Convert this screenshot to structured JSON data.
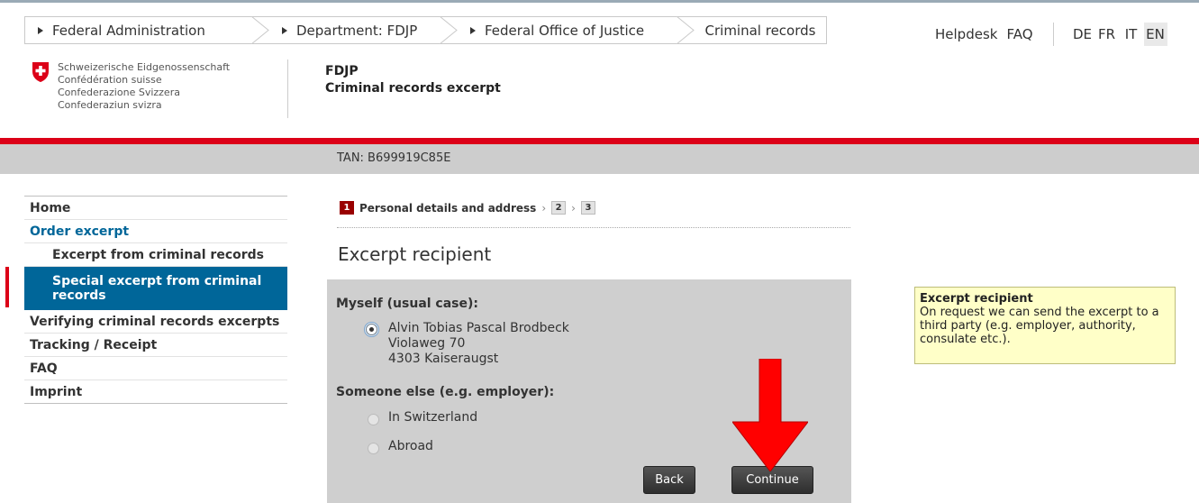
{
  "breadcrumb": {
    "items": [
      {
        "label": "Federal Administration"
      },
      {
        "label": "Department: FDJP"
      },
      {
        "label": "Federal Office of Justice"
      },
      {
        "label": "Criminal records"
      }
    ]
  },
  "meta_nav": {
    "helpdesk": "Helpdesk",
    "faq": "FAQ",
    "languages": [
      "DE",
      "FR",
      "IT",
      "EN"
    ],
    "active_language": "EN"
  },
  "logo": {
    "lines": [
      "Schweizerische Eidgenossenschaft",
      "Confédération suisse",
      "Confederazione Svizzera",
      "Confederaziun svizra"
    ]
  },
  "site": {
    "department": "FDJP",
    "title": "Criminal records excerpt"
  },
  "tan": "TAN: B699919C85E",
  "side_nav": {
    "items": [
      {
        "label": "Home"
      },
      {
        "label": "Order excerpt"
      },
      {
        "label": "Excerpt from criminal records"
      },
      {
        "label": "Special excerpt from criminal records"
      },
      {
        "label": "Verifying criminal records excerpts"
      },
      {
        "label": "Tracking / Receipt"
      },
      {
        "label": "FAQ"
      },
      {
        "label": "Imprint"
      }
    ]
  },
  "steps": {
    "current_number": "1",
    "current_label": "Personal details and address",
    "step2": "2",
    "step3": "3",
    "separator": "›"
  },
  "form": {
    "heading": "Excerpt recipient",
    "myself_label": "Myself (usual case):",
    "myself_option": {
      "name": "Alvin Tobias Pascal Brodbeck",
      "street": "Violaweg 70",
      "city": "4303 Kaiseraugst"
    },
    "someone_else_label": "Someone else (e.g. employer):",
    "option_switzerland": "In Switzerland",
    "option_abroad": "Abroad",
    "back_label": "Back",
    "continue_label": "Continue"
  },
  "help": {
    "title": "Excerpt recipient",
    "text": "On request we can send the excerpt to a third party (e.g. employer, authority, consulate etc.)."
  },
  "colors": {
    "swiss_red": "#dc0018",
    "nav_blue": "#006699",
    "step_active": "#990000",
    "arrow_red": "#ff0000",
    "help_bg": "#ffffc8"
  }
}
